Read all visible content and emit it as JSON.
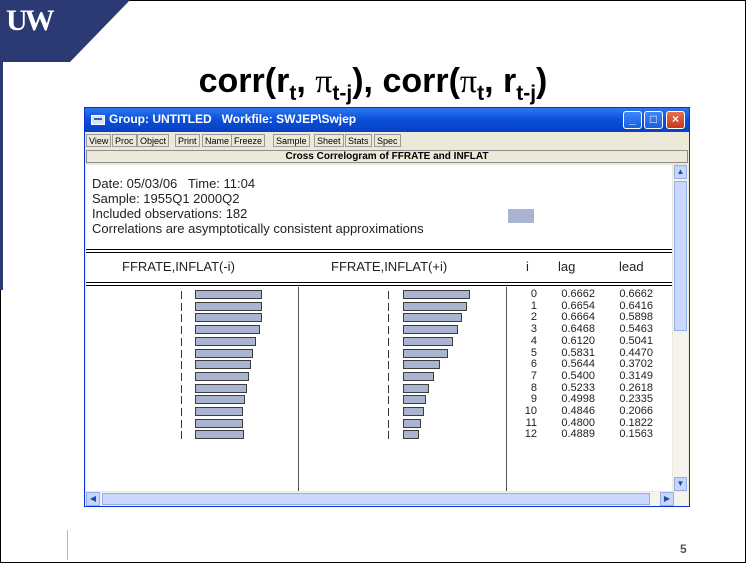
{
  "slide": {
    "logo_text": "UW",
    "title_parts": {
      "corr1": "corr(r",
      "sub_t": "t",
      "comma": ", ",
      "pi": "π",
      "sub_tj": "t-j",
      "mid": "), corr(",
      "pi2": "π",
      "sub_t2": "t",
      "comma2": ", r",
      "sub_tj2": "t-j",
      "end": ")"
    },
    "page_number": "5",
    "colors": {
      "logo_bg": "#2b3a72",
      "titlebar": "#0a4fd8",
      "bar_fill": "#a8b4d0"
    }
  },
  "window": {
    "title": "Group: UNTITLED   Workfile: SWJEP\\Swjep",
    "controls": {
      "minimize": "_",
      "maximize": "□",
      "close": "×"
    },
    "toolbar": [
      "View",
      "Proc",
      "Object",
      "Print",
      "Name",
      "Freeze",
      "Sample",
      "Sheet",
      "Stats",
      "Spec"
    ],
    "header": "Cross Correlogram of FFRATE and INFLAT",
    "info": {
      "date_line": "Date: 05/03/06   Time: 11:04",
      "sample_line": "Sample: 1955Q1 2000Q2",
      "obs_line": "Included observations: 182",
      "note_line": "Correlations are asymptotically consistent approximations"
    },
    "columns": {
      "left": "FFRATE,INFLAT(-i)",
      "right": "FFRATE,INFLAT(+i)",
      "i": "i",
      "lag": "lag",
      "lead": "lead"
    },
    "rows": [
      {
        "i": "0",
        "lag": "0.6662",
        "lead": "0.6662"
      },
      {
        "i": "1",
        "lag": "0.6654",
        "lead": "0.6416"
      },
      {
        "i": "2",
        "lag": "0.6664",
        "lead": "0.5898"
      },
      {
        "i": "3",
        "lag": "0.6468",
        "lead": "0.5463"
      },
      {
        "i": "4",
        "lag": "0.6120",
        "lead": "0.5041"
      },
      {
        "i": "5",
        "lag": "0.5831",
        "lead": "0.4470"
      },
      {
        "i": "6",
        "lag": "0.5644",
        "lead": "0.3702"
      },
      {
        "i": "7",
        "lag": "0.5400",
        "lead": "0.3149"
      },
      {
        "i": "8",
        "lag": "0.5233",
        "lead": "0.2618"
      },
      {
        "i": "9",
        "lag": "0.4998",
        "lead": "0.2335"
      },
      {
        "i": "10",
        "lag": "0.4846",
        "lead": "0.2066"
      },
      {
        "i": "11",
        "lag": "0.4800",
        "lead": "0.1822"
      },
      {
        "i": "12",
        "lag": "0.4889",
        "lead": "0.1563"
      }
    ]
  }
}
